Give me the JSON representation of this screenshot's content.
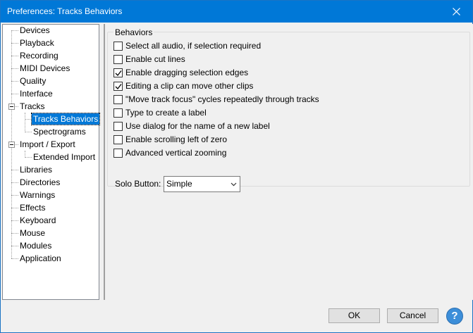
{
  "window": {
    "title": "Preferences: Tracks Behaviors"
  },
  "tree": {
    "items": [
      {
        "label": "Devices"
      },
      {
        "label": "Playback"
      },
      {
        "label": "Recording"
      },
      {
        "label": "MIDI Devices"
      },
      {
        "label": "Quality"
      },
      {
        "label": "Interface"
      },
      {
        "label": "Tracks"
      },
      {
        "label": "Tracks Behaviors"
      },
      {
        "label": "Spectrograms"
      },
      {
        "label": "Import / Export"
      },
      {
        "label": "Extended Import"
      },
      {
        "label": "Libraries"
      },
      {
        "label": "Directories"
      },
      {
        "label": "Warnings"
      },
      {
        "label": "Effects"
      },
      {
        "label": "Keyboard"
      },
      {
        "label": "Mouse"
      },
      {
        "label": "Modules"
      },
      {
        "label": "Application"
      }
    ],
    "selected": "Tracks Behaviors"
  },
  "behaviors": {
    "group_label": "Behaviors",
    "options": [
      {
        "label": "Select all audio, if selection required",
        "checked": false
      },
      {
        "label": "Enable cut lines",
        "checked": false
      },
      {
        "label": "Enable dragging selection edges",
        "checked": true
      },
      {
        "label": "Editing a clip can move other clips",
        "checked": true
      },
      {
        "label": "\"Move track focus\" cycles repeatedly through tracks",
        "checked": false
      },
      {
        "label": "Type to create a label",
        "checked": false
      },
      {
        "label": "Use dialog for the name of a new label",
        "checked": false
      },
      {
        "label": "Enable scrolling left of zero",
        "checked": false
      },
      {
        "label": "Advanced vertical zooming",
        "checked": false
      }
    ],
    "solo_label": "Solo Button:",
    "solo_value": "Simple"
  },
  "buttons": {
    "ok": "OK",
    "cancel": "Cancel",
    "help": "?"
  }
}
